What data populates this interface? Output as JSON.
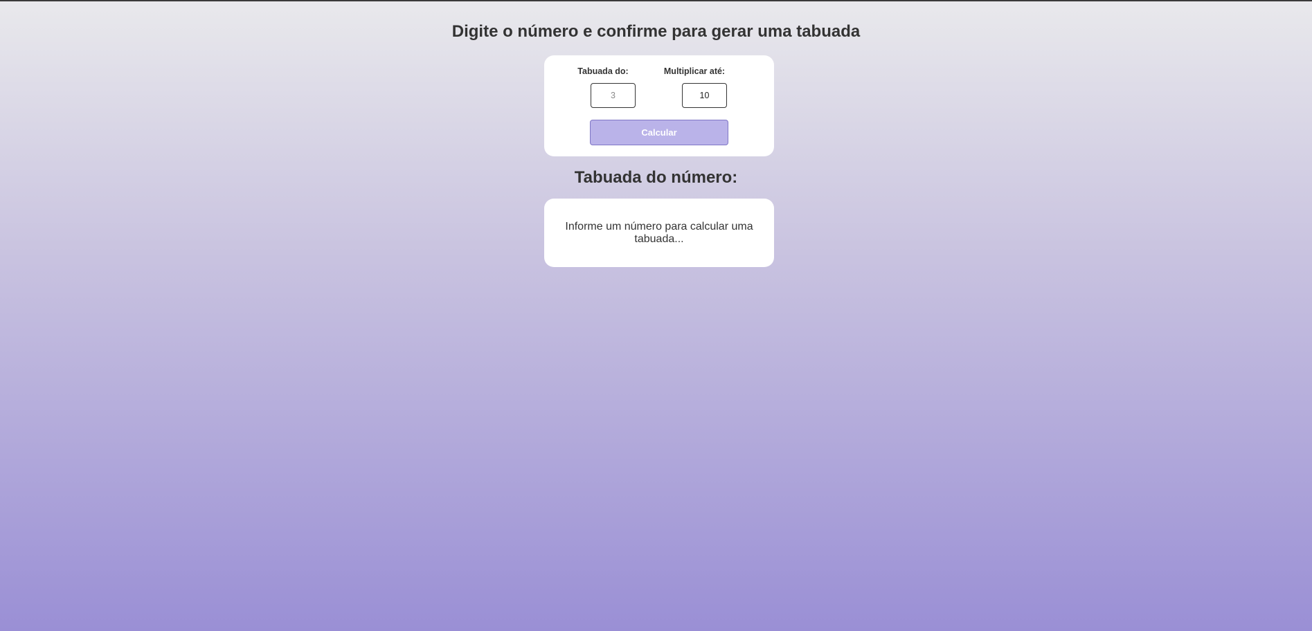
{
  "header": {
    "title": "Digite o número e confirme para gerar uma tabuada"
  },
  "form": {
    "table_label": "Tabuada do:",
    "table_placeholder": "3",
    "limit_label": "Multiplicar até:",
    "limit_value": "10",
    "calculate_label": "Calcular"
  },
  "result": {
    "title": "Tabuada do número:",
    "message": "Informe um número para calcular uma tabuada..."
  },
  "colors": {
    "button_fill": "#bab3e9",
    "button_border": "#7f76c6",
    "gradient_top": "#e9e9ec",
    "gradient_bottom": "#9a8fd5"
  }
}
